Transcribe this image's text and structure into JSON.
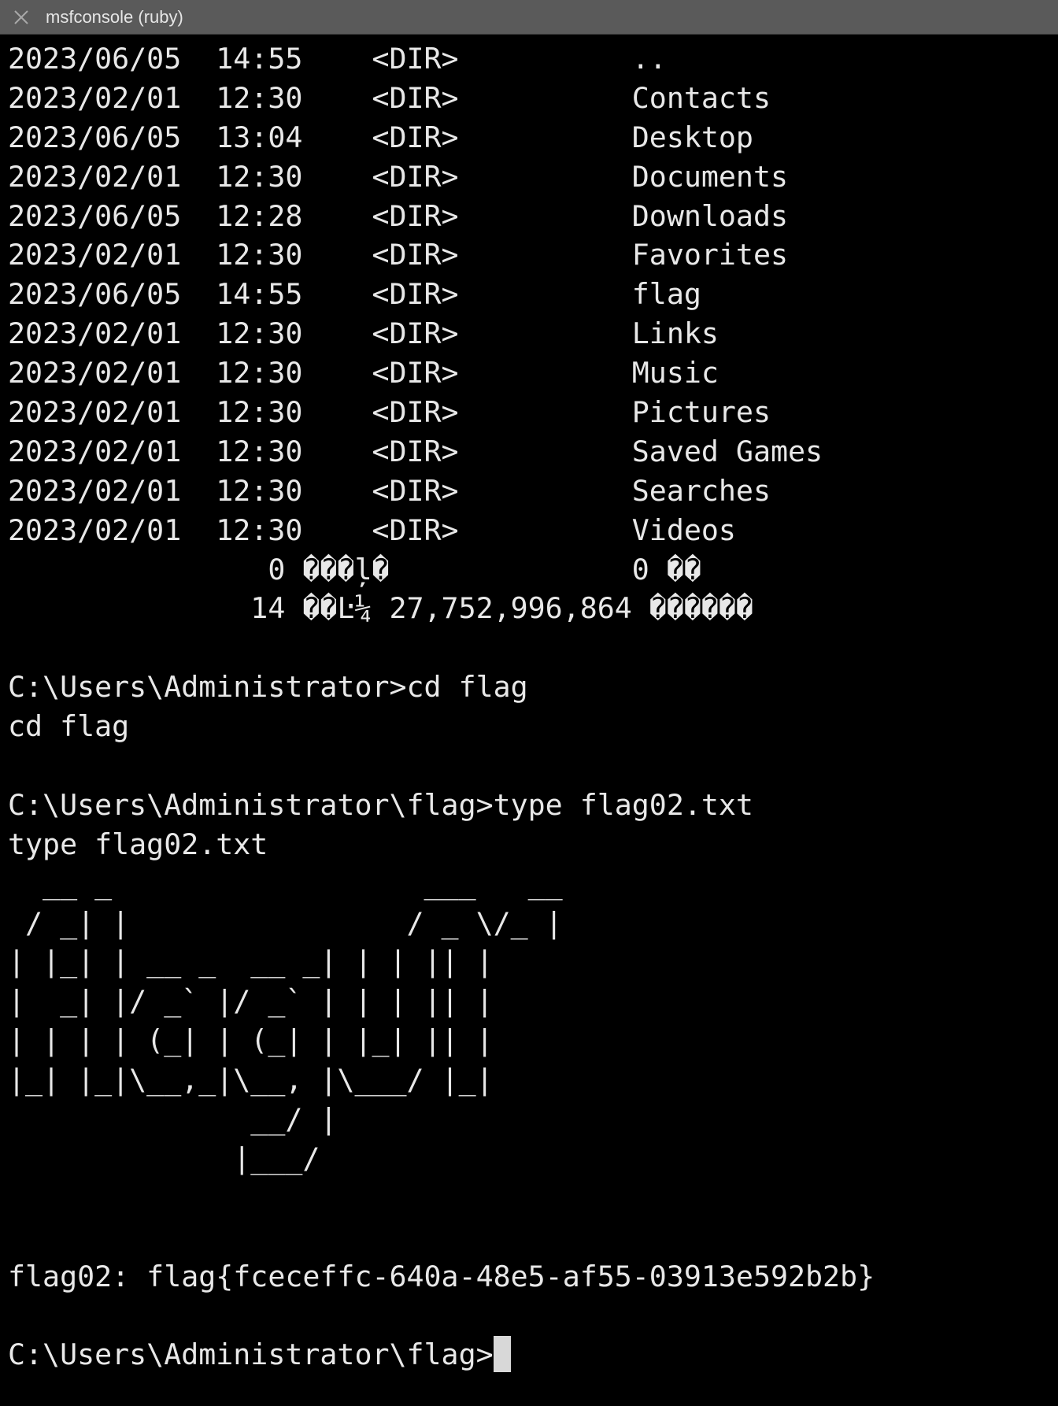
{
  "window": {
    "title": "msfconsole (ruby)",
    "close_icon": "close-x-icon"
  },
  "terminal": {
    "lines": [
      "2023/06/05  14:55    <DIR>          ..",
      "2023/02/01  12:30    <DIR>          Contacts",
      "2023/06/05  13:04    <DIR>          Desktop",
      "2023/02/01  12:30    <DIR>          Documents",
      "2023/06/05  12:28    <DIR>          Downloads",
      "2023/02/01  12:30    <DIR>          Favorites",
      "2023/06/05  14:55    <DIR>          flag",
      "2023/02/01  12:30    <DIR>          Links",
      "2023/02/01  12:30    <DIR>          Music",
      "2023/02/01  12:30    <DIR>          Pictures",
      "2023/02/01  12:30    <DIR>          Saved Games",
      "2023/02/01  12:30    <DIR>          Searches",
      "2023/02/01  12:30    <DIR>          Videos",
      "               0 ���ļ�              0 ��",
      "              14 ��Ŀ¼ 27,752,996,864 ������",
      "",
      "C:\\Users\\Administrator>cd flag",
      "cd flag",
      "",
      "C:\\Users\\Administrator\\flag>type flag02.txt",
      "type flag02.txt",
      "  __ _                  ___   __",
      " / _| |                / _ \\/_ |",
      "| |_| | __ _  __ _| | | || |",
      "|  _| |/ _` |/ _` | | | || |",
      "| | | | (_| | (_| | |_| || |",
      "|_| |_|\\__,_|\\__, |\\___/ |_|",
      "              __/ |",
      "             |___/",
      "",
      "",
      "flag02: flag{fceceffc-640a-48e5-af55-03913e592b2b}",
      ""
    ],
    "prompt": "C:\\Users\\Administrator\\flag>"
  },
  "colors": {
    "background": "#000000",
    "foreground": "#e8e8e8",
    "titlebar": "#5a5a5a",
    "cursor": "#d8d8d8"
  }
}
